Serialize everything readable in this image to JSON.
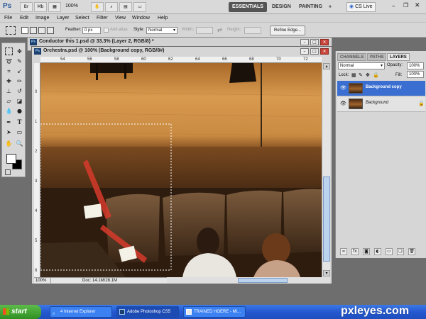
{
  "app": {
    "logo": "Ps",
    "zoom": "100%",
    "workspaces": [
      "ESSENTIALS",
      "DESIGN",
      "PAINTING"
    ],
    "more": "»",
    "cs_live": "CS Live"
  },
  "menu": [
    "File",
    "Edit",
    "Image",
    "Layer",
    "Select",
    "Filter",
    "View",
    "Window",
    "Help"
  ],
  "options": {
    "feather_label": "Feather:",
    "feather_value": "0 px",
    "antialias_label": "Anti-alias",
    "style_label": "Style:",
    "style_value": "Normal",
    "width_label": "Width:",
    "height_label": "Height:",
    "refine_label": "Refine Edge..."
  },
  "documents": {
    "back_title": "Conductor this 1.psd @ 33.3% (Layer 2, RGB/8) *",
    "front_title": "Orchestra.psd @ 100% (Background copy, RGB/8#)",
    "ruler_top": [
      "54",
      "56",
      "58",
      "60",
      "62",
      "64",
      "66",
      "68",
      "70",
      "72"
    ],
    "ruler_left": [
      "0",
      "1",
      "2",
      "3",
      "4",
      "5",
      "6"
    ],
    "status_zoom": "100%",
    "status_doc": "Doc: 14.1M/28.1M"
  },
  "panel": {
    "tabs": [
      "CHANNELS",
      "PATHS",
      "LAYERS"
    ],
    "blend_mode": "Normal",
    "opacity_label": "Opacity:",
    "opacity_value": "100%",
    "lock_label": "Lock:",
    "fill_label": "Fill:",
    "fill_value": "100%",
    "layers": [
      {
        "name": "Background copy",
        "selected": true
      },
      {
        "name": "Background",
        "selected": false
      }
    ]
  },
  "taskbar": {
    "start": "start",
    "tasks": [
      "4 Internet Explorer",
      "Adobe Photoshop CS5",
      "TRAINED HOERE - Mi..."
    ],
    "watermark": "pxleyes.com"
  }
}
